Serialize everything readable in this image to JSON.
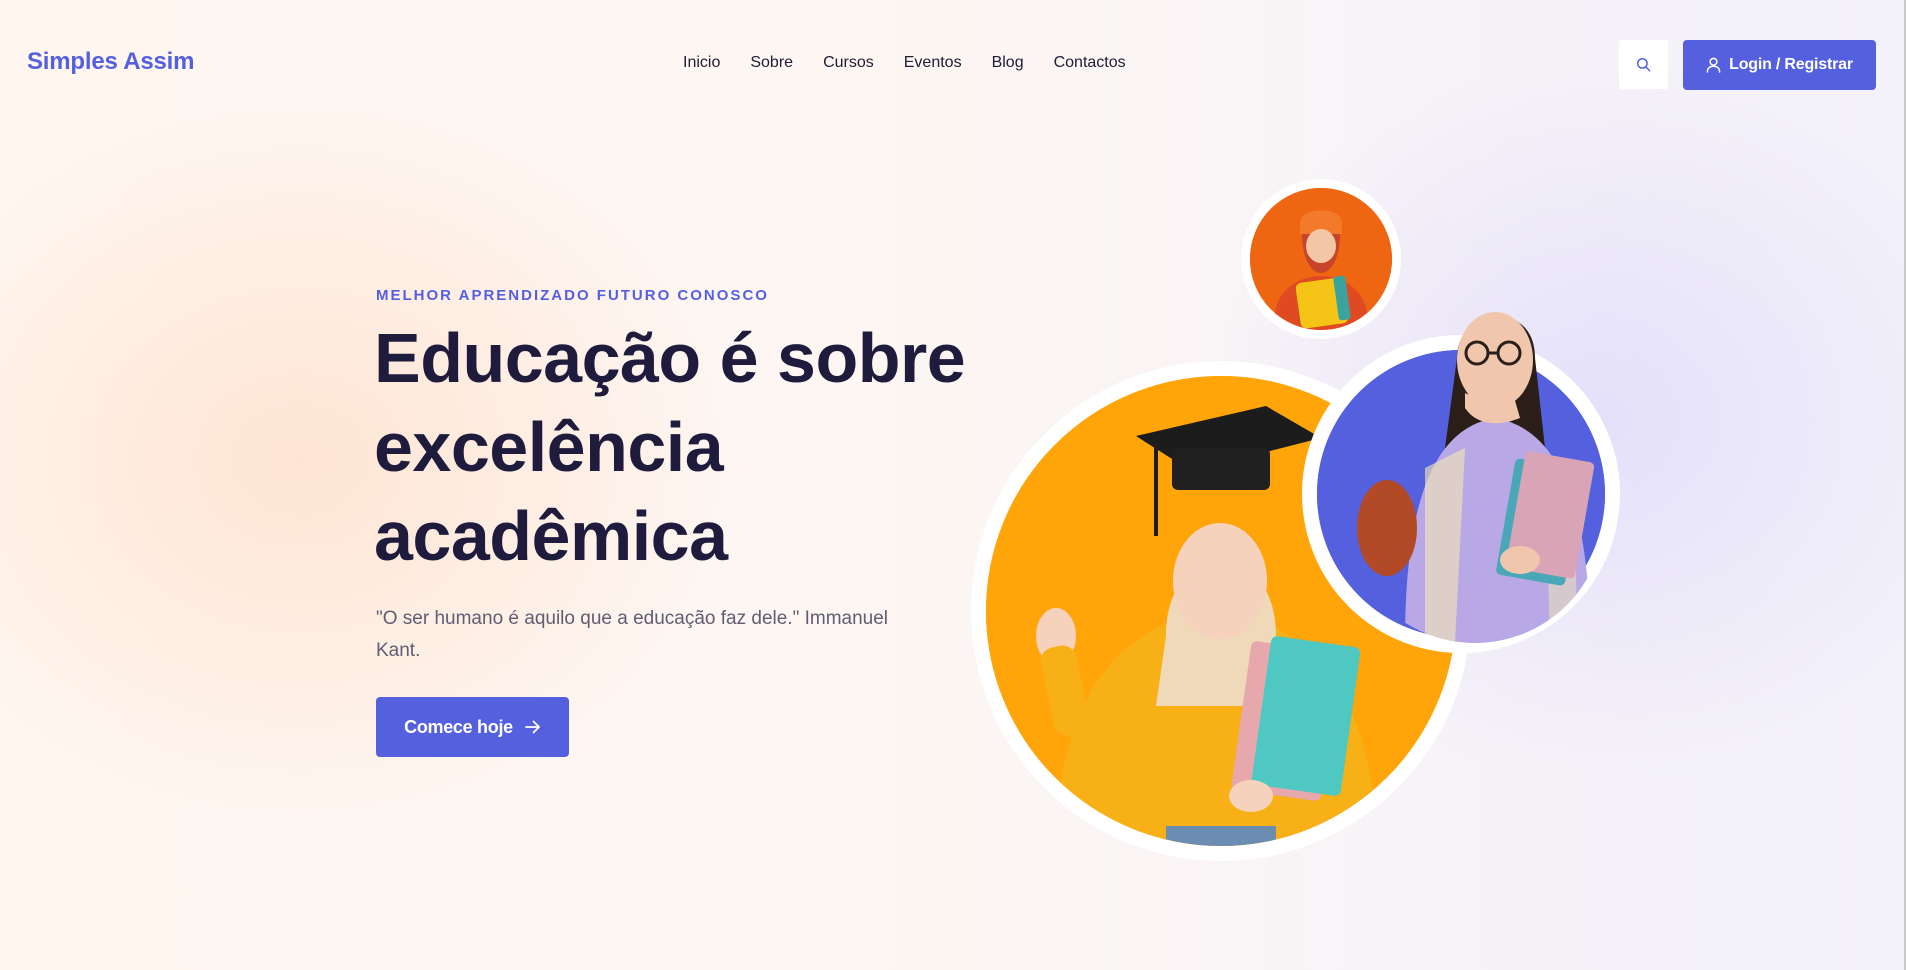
{
  "header": {
    "logo": "Simples Assim",
    "nav": [
      "Inicio",
      "Sobre",
      "Cursos",
      "Eventos",
      "Blog",
      "Contactos"
    ],
    "search_icon": "search-icon",
    "login_icon": "user-icon",
    "login_label": "Login / Registrar"
  },
  "hero": {
    "eyebrow": "MELHOR APRENDIZADO FUTURO CONOSCO",
    "headline_lines": [
      "Educação é sobre",
      "excelência",
      "acadêmica"
    ],
    "quote": "\"O ser humano é aquilo que a educação faz dele.\" Immanuel Kant.",
    "cta_label": "Comece hoje",
    "cta_icon": "arrow-right-icon"
  },
  "images": {
    "small": "student-orange-hat-photo",
    "large": "student-graduation-cap-photo",
    "medium": "student-glasses-photo"
  },
  "colors": {
    "brand": "#5560df",
    "heading": "#1e1b3d",
    "body_text": "#5f5e72",
    "photo_orange": "#ee6512",
    "photo_yellow": "#ffa50a",
    "photo_blue": "#5560df"
  }
}
